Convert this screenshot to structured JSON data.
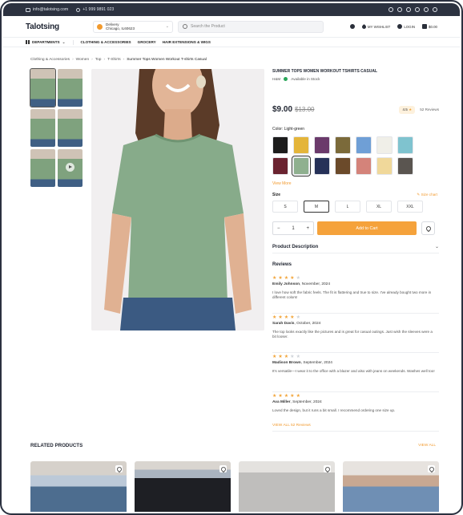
{
  "topbar": {
    "email": "info@talotsing.com",
    "phone": "+1 999 9891 023",
    "social_icons": [
      "facebook-icon",
      "instagram-icon",
      "x-icon",
      "tiktok-icon",
      "youtube-icon",
      "whatsapp-icon"
    ]
  },
  "header": {
    "logo": "Talotsing",
    "delivery_label": "Delivery",
    "delivery_location": "Chicago, IL60623",
    "search_placeholder": "Search the Product",
    "wishlist": "MY WISHLIST",
    "login": "LOGIN",
    "cart_total": "$0.00"
  },
  "nav": {
    "departments": "DEPARTMENTS",
    "links": [
      "CLOTHING & ACCESSORIES",
      "GROCERY",
      "HAIR EXTENSIONS & WIGS"
    ]
  },
  "breadcrumb": [
    "Clothing & Accessories",
    "Women",
    "Top",
    "T-Shirts",
    "Summer Tops Women Workout T-shirts Casual"
  ],
  "product": {
    "title": "SUMMER TOPS WOMEN WORKOUT TSHIRTS CASUAL",
    "brand": "H&M",
    "availability": "Available in Stock",
    "price": "$9.00",
    "old_price": "$13.00",
    "rating": "4.5",
    "review_count": "52 Reviews",
    "color_label": "Color: Light-green",
    "colors": [
      "#1c1c1c",
      "#e4b53a",
      "#6b3a6b",
      "#7b6a3a",
      "#6f9fd6",
      "#f0efe8",
      "#7fc3cf",
      "#6a2330",
      "#8fb08f",
      "#263158",
      "#6b4a2a",
      "#d4837a",
      "#f0d89a",
      "#5a5550"
    ],
    "selected_color_index": 8,
    "view_more": "View More",
    "size_label": "Size",
    "size_chart": "Size chart",
    "sizes": [
      "S",
      "M",
      "L",
      "XL",
      "XXL"
    ],
    "selected_size_index": 1,
    "quantity": "1",
    "add_to_cart": "Add to Cart",
    "description_label": "Product Description"
  },
  "reviews": {
    "title": "Reviews",
    "items": [
      {
        "stars": 4,
        "author": "Emily Johnson",
        "date": "November, 2024",
        "text": "I love how soft the fabric feels. The fit is flattering and true to size. I've already bought two more in different colors!"
      },
      {
        "stars": 4,
        "author": "Sarah Davis",
        "date": "October, 2024",
        "text": "The top looks exactly like the pictures and is great for casual outings. Just wish the sleeves were a bit looser."
      },
      {
        "stars": 3,
        "author": "Madison Brown",
        "date": "September, 2024",
        "text": "It's versatile—I wear it to the office with a blazer and also with jeans on weekends. Washes well too!"
      },
      {
        "stars": 5,
        "author": "Ava Miller",
        "date": "September, 2024",
        "text": "Loved the design, but it runs a bit small. I recommend ordering one size up."
      }
    ],
    "view_all": "VIEW ALL 52 Reviews"
  },
  "related": {
    "title": "RELATED PRODUCTS",
    "view_all": "VIEW ALL"
  }
}
